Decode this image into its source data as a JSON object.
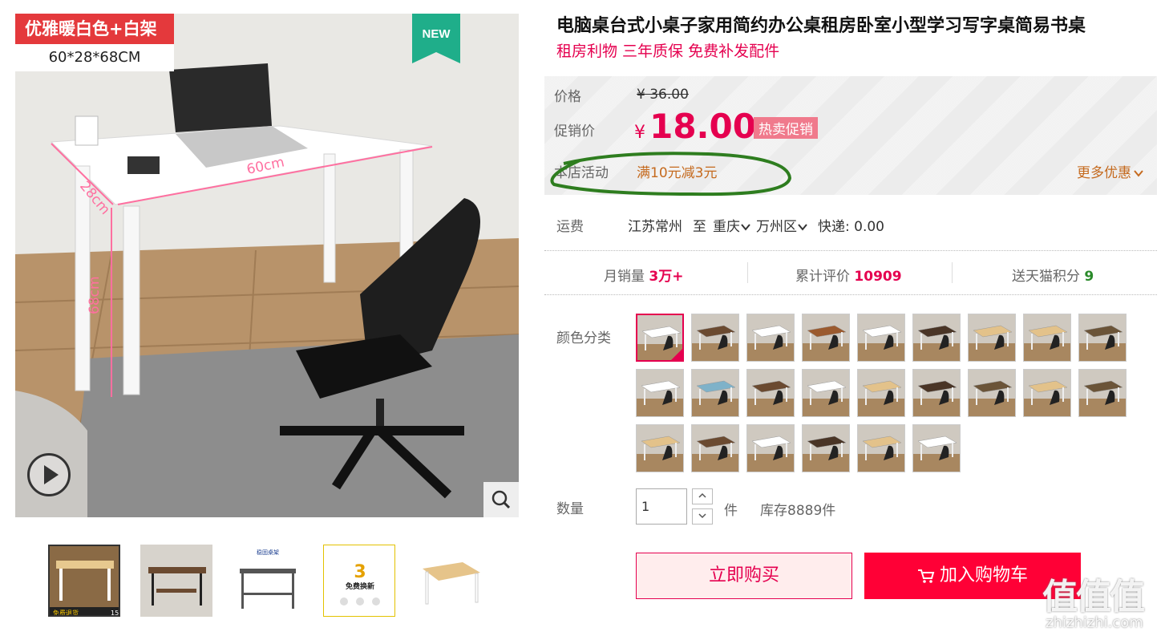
{
  "gallery": {
    "tag_color": "优雅暖白色+白架",
    "tag_size": "60*28*68CM",
    "new_label": "NEW",
    "dim_depth": "28cm",
    "dim_width": "60cm",
    "dim_height": "68cm",
    "thumb1_caption": "免费退货",
    "thumb1_badge": "15",
    "thumb3_caption": "稳固桌架",
    "thumb4_caption": "免费换新",
    "thumb4_number": "3"
  },
  "product": {
    "title": "电脑桌台式小桌子家用简约办公桌租房卧室小型学习写字桌简易书桌",
    "subtitle": "租房利物 三年质保 免费补发配件"
  },
  "price": {
    "label_price": "价格",
    "original": "¥ 36.00",
    "label_promo": "促销价",
    "currency": "¥",
    "promo": "18.00",
    "hot_badge": "热卖促销",
    "label_activity": "本店活动",
    "activity": "满10元减3元",
    "more_deals": "更多优惠"
  },
  "shipping": {
    "label": "运费",
    "from": "江苏常州",
    "to_word": "至",
    "province": "重庆",
    "district": "万州区",
    "express": "快递: 0.00"
  },
  "stats": {
    "monthly_label": "月销量",
    "monthly_value": "3万+",
    "reviews_label": "累计评价",
    "reviews_value": "10909",
    "points_label": "送天猫积分",
    "points_value": "9"
  },
  "options": {
    "color_label": "颜色分类",
    "swatch_count": 24,
    "selected_index": 0
  },
  "quantity": {
    "label": "数量",
    "value": "1",
    "unit": "件",
    "stock": "库存8889件"
  },
  "actions": {
    "buy_now": "立即购买",
    "add_to_cart": "加入购物车"
  },
  "watermark": {
    "logo": "值值值",
    "url": "zhizhizhi.com"
  },
  "colors": {
    "brand_red": "#e5004f",
    "cart_red": "#ff0036",
    "activity_orange": "#c56a1e",
    "annotation_green": "#2e7d1f"
  },
  "icons": [
    "play-icon",
    "magnifier-icon",
    "chevron-down-icon",
    "cart-icon",
    "check-icon"
  ]
}
